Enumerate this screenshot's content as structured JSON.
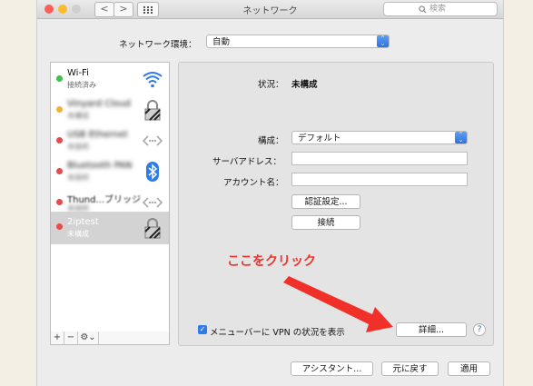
{
  "window": {
    "title": "ネットワーク",
    "search_placeholder": "検索"
  },
  "toolbar": {
    "back": "<",
    "forward": ">"
  },
  "location": {
    "label": "ネットワーク環境：",
    "value": "自動"
  },
  "services": [
    {
      "name": "Wi-Fi",
      "status": "接続済み",
      "dot": "#3cc24a",
      "icon": "wifi-icon"
    },
    {
      "name": "Vinyard Cloud",
      "status": "未構成",
      "dot": "#f2b233",
      "icon": "lock-icon"
    },
    {
      "name": "USB Ethernet",
      "status": "未接続",
      "dot": "#e84a4a",
      "icon": "ethernet-icon"
    },
    {
      "name": "Bluetooth PAN",
      "status": "未接続",
      "dot": "#e84a4a",
      "icon": "bluetooth-icon"
    },
    {
      "name": "Thund...ブリッジ",
      "status": "未接続",
      "dot": "#e84a4a",
      "icon": "ethernet-icon"
    },
    {
      "name": "2iptest",
      "status": "未構成",
      "dot": "#e84a4a",
      "icon": "lock-icon"
    }
  ],
  "sidebar_controls": {
    "add": "+",
    "remove": "−",
    "gear": "⚙︎⌄"
  },
  "detail": {
    "status_label": "状況：",
    "status_value": "未構成",
    "config_label": "構成：",
    "config_value": "デフォルト",
    "server_label": "サーバアドレス：",
    "account_label": "アカウント名：",
    "auth_button": "認証設定...",
    "connect_button": "接続",
    "show_vpn_label": "メニューバーに VPN の状況を表示",
    "advanced_button": "詳細...",
    "help": "?"
  },
  "bottom": {
    "assistant": "アシスタント...",
    "revert": "元に戻す",
    "apply": "適用"
  },
  "annotation": {
    "text": "ここをクリック"
  },
  "colors": {
    "accent": "#2f7ce6",
    "arrow": "#f2302a",
    "close": "#fc5f57",
    "minimize": "#fdbc2e",
    "maximize": "#cfcfcf"
  }
}
